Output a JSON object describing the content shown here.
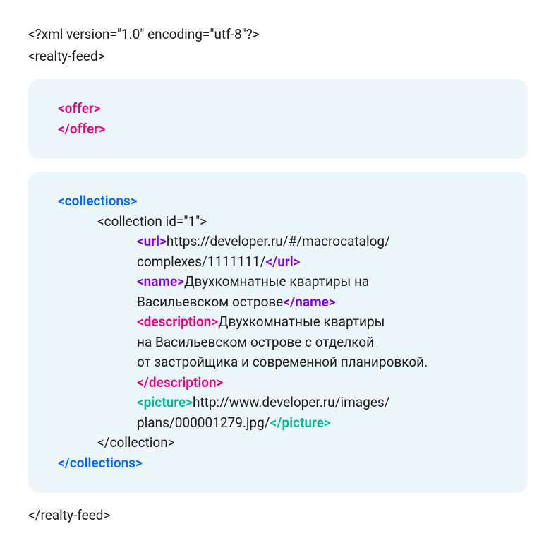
{
  "xml_declaration": "<?xml version=\"1.0\" encoding=\"utf-8\"?>",
  "root_open": "<realty-feed>",
  "root_close": "</realty-feed>",
  "offer": {
    "open": "<offer>",
    "close": "</offer>"
  },
  "collections": {
    "open": "<collections>",
    "close": "</collections>",
    "collection": {
      "open": "<collection id=\"1\">",
      "close": "</collection>",
      "url": {
        "open": "<url>",
        "close": "</url>",
        "value_line1": "https://developer.ru/#/macrocatalog/",
        "value_line2": "complexes/1111111/"
      },
      "name": {
        "open": "<name>",
        "close": "</name>",
        "value_line1": "Двухкомнатные квартиры на",
        "value_line2": "Васильевском острове"
      },
      "description": {
        "open": "<description>",
        "close": "</description>",
        "value_line1": "Двухкомнатные квартиры",
        "value_line2": "на Васильевском острове с отделкой",
        "value_line3": "от застройщика и современной планировкой."
      },
      "picture": {
        "open": "<picture>",
        "close": "</picture>",
        "value_line1": "http://www.developer.ru/images/",
        "value_line2": "plans/000001279.jpg/"
      }
    }
  }
}
